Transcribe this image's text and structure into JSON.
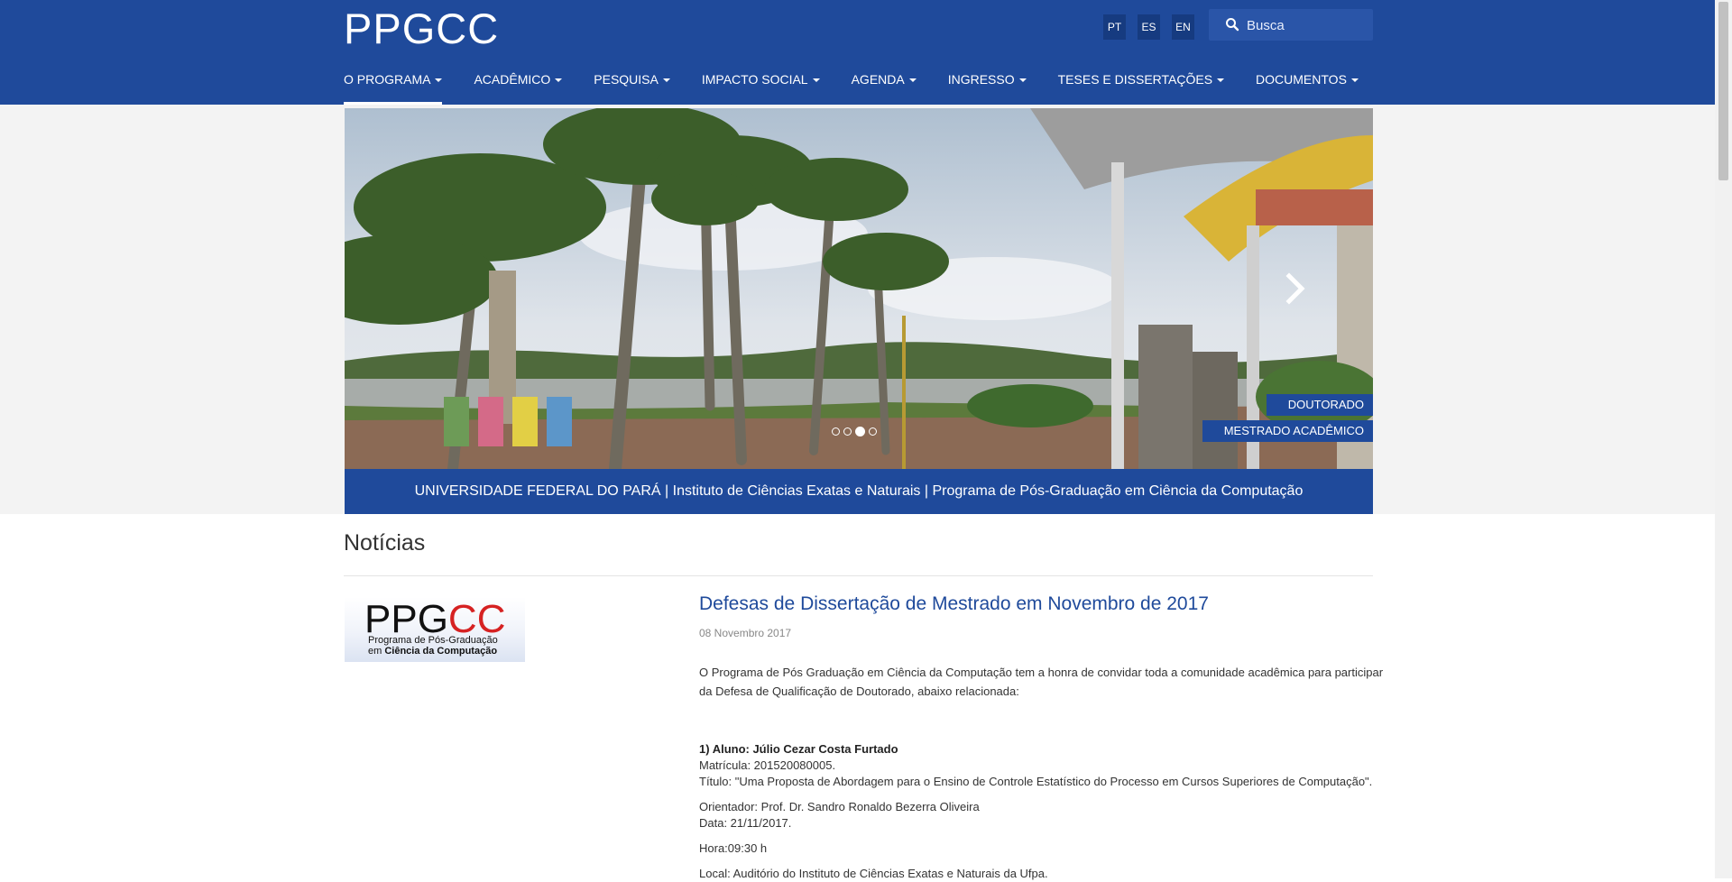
{
  "header": {
    "logo": "PPGCC",
    "languages": [
      "PT",
      "ES",
      "EN"
    ],
    "search_placeholder": "Busca"
  },
  "nav": {
    "items": [
      {
        "label": "O PROGRAMA"
      },
      {
        "label": "ACADÊMICO"
      },
      {
        "label": "PESQUISA"
      },
      {
        "label": "IMPACTO SOCIAL"
      },
      {
        "label": "AGENDA"
      },
      {
        "label": "INGRESSO"
      },
      {
        "label": "TESES E DISSERTAÇÕES"
      },
      {
        "label": "DOCUMENTOS"
      }
    ]
  },
  "banner": {
    "tags": [
      "DOUTORADO",
      "MESTRADO ACADÊMICO"
    ],
    "caption": "UNIVERSIDADE FEDERAL DO PARÁ | Instituto de Ciências Exatas e Naturais | Programa de Pós-Graduação em Ciência da Computação",
    "dot_count": 4,
    "active_dot": 2
  },
  "news": {
    "section_title": "Notícias",
    "thumb": {
      "brand_black": "PPG",
      "brand_red": "CC",
      "line1": "Programa de Pós-Graduação",
      "line2_prefix": "em",
      "line2_bold": "Ciência da Computação"
    },
    "title": "Defesas de Dissertação de Mestrado em Novembro de 2017",
    "date": "08 Novembro 2017",
    "intro_line1": "O Programa de Pós Graduação em Ciência da Computação tem a honra de convidar toda a comunidade acadêmica para participar",
    "intro_line2": "da Defesa de Qualificação de Doutorado, abaixo relacionada:",
    "student": "1) Aluno: Júlio Cezar Costa Furtado",
    "matricula": "Matrícula: 201520080005.",
    "titulo": "Título: \"Uma Proposta de Abordagem para o Ensino de Controle Estatístico do Processo em Cursos Superiores de Computação\".",
    "orientador": "Orientador: Prof. Dr. Sandro Ronaldo Bezerra Oliveira",
    "data": "Data: 21/11/2017.",
    "hora": "Hora:09:30 h",
    "local": "Local: Auditório  do Instituto de Ciências Exatas e Naturais da Ufpa."
  },
  "colors": {
    "primary": "#1f4a9b",
    "link": "#1f4a9b",
    "banner_bg": "#f3f3f3"
  }
}
